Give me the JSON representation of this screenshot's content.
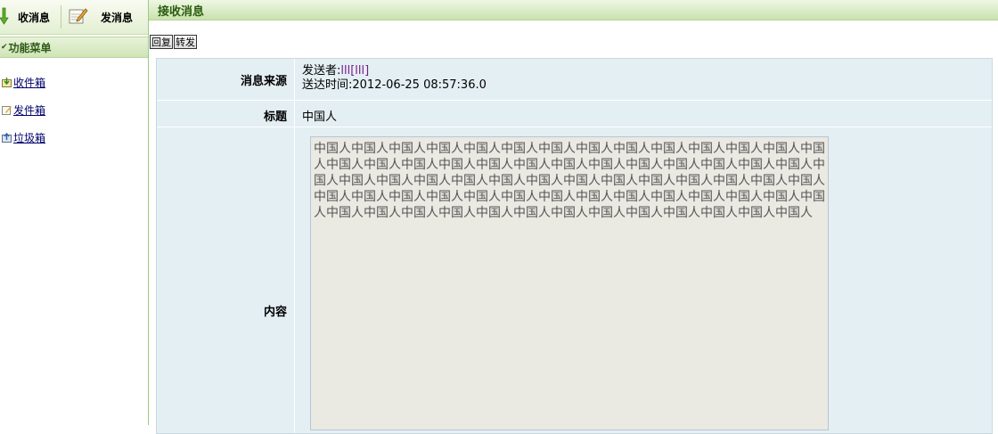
{
  "toolbar": {
    "receive_label": "收消息",
    "send_label": "发消息"
  },
  "menu": {
    "header": "功能菜单",
    "items": [
      {
        "label": "收件箱",
        "icon": "inbox-icon"
      },
      {
        "label": "发件箱",
        "icon": "outbox-icon"
      },
      {
        "label": "垃圾箱",
        "icon": "trash-icon"
      }
    ]
  },
  "page": {
    "title": "接收消息"
  },
  "actions": {
    "reply": "回复",
    "forward": "转发"
  },
  "message": {
    "source_label": "消息来源",
    "sender_prefix": "发送者:",
    "sender_name": "lll[lll]",
    "time_prefix": "送达时间:",
    "time_value": "2012-06-25 08:57:36.0",
    "subject_label": "标题",
    "subject_value": "中国人",
    "content_label": "内容",
    "content_text": "中国人中国人中国人中国人中国人中国人中国人中国人中国人中国人中国人中国人中国人中国人中国人中国人中国人中国人中国人中国人中国人中国人中国人中国人中国人中国人中国人中国人中国人中国人中国人中国人中国人中国人中国人中国人中国人中国人中国人中国人中国人中国人中国人中国人中国人中国人中国人中国人中国人中国人中国人中国人中国人中国人中国人中国人中国人中国人中国人中国人中国人中国人中国人中国人中国人中国人中国人中国人"
  }
}
